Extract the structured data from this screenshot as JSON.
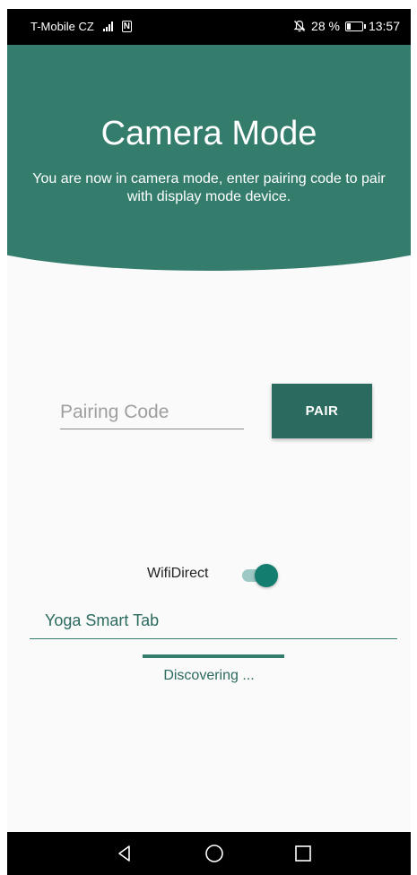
{
  "status_bar": {
    "carrier": "T-Mobile CZ",
    "nfc_label": "N",
    "battery_percent": "28 %",
    "battery_level": 0.28,
    "time": "13:57",
    "icons": [
      "signal-icon",
      "nfc-icon",
      "mute-icon",
      "battery-icon"
    ]
  },
  "header": {
    "title": "Camera Mode",
    "subtitle": "You are now in camera mode, enter pairing code to pair with display mode device."
  },
  "pairing": {
    "placeholder": "Pairing Code",
    "value": "",
    "button_label": "PAIR"
  },
  "wifi_direct": {
    "label": "WifiDirect",
    "enabled": true
  },
  "device": {
    "name": "Yoga Smart Tab"
  },
  "discovery": {
    "status": "Discovering ..."
  },
  "navigation": {
    "icons": [
      "back-icon",
      "home-icon",
      "recents-icon"
    ]
  },
  "colors": {
    "primary": "#347d6d",
    "primary_dark": "#2b6a5e",
    "accent": "#137d6f",
    "background": "#fafafa"
  }
}
